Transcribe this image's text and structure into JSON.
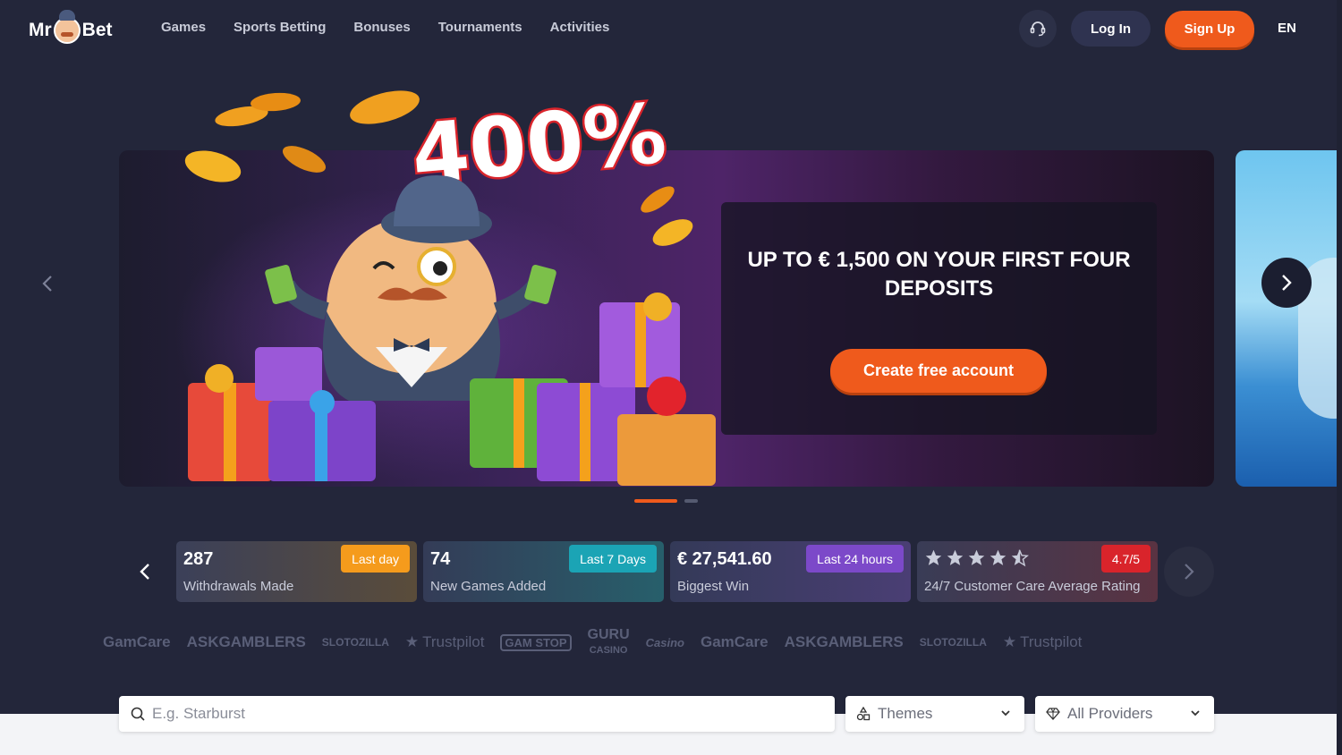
{
  "brand": {
    "name_left": "Mr",
    "name_right": "Bet"
  },
  "nav": {
    "items": [
      "Games",
      "Sports Betting",
      "Bonuses",
      "Tournaments",
      "Activities"
    ]
  },
  "header": {
    "login_label": "Log In",
    "signup_label": "Sign Up",
    "language": "EN",
    "support_icon": "headset-icon"
  },
  "hero": {
    "headline": "400%",
    "promo_title": "UP TO € 1,500 ON YOUR FIRST FOUR DEPOSITS",
    "cta_label": "Create free account",
    "slides_total": 2,
    "active_slide": 1
  },
  "stats": [
    {
      "value": "287",
      "label": "Withdrawals Made",
      "badge": "Last day",
      "badge_color": "#f59b1c"
    },
    {
      "value": "74",
      "label": "New Games Added",
      "badge": "Last 7 Days",
      "badge_color": "#1ba4b5"
    },
    {
      "value": "€ 27,541.60",
      "label": "Biggest Win",
      "badge": "Last 24 hours",
      "badge_color": "#7c49c9"
    },
    {
      "rating_stars": 4.5,
      "label": "24/7 Customer Care Average Rating",
      "badge": "4.7/5",
      "badge_color": "#d9242b"
    }
  ],
  "trust_logos": [
    "GamCare",
    "ASKGAMBLERS",
    "SLOTOZILLA",
    "Trustpilot",
    "GAM STOP",
    "GURU",
    "CASINO",
    "Casino",
    "GamCare",
    "ASKGAMBLERS",
    "SLOTOZILLA",
    "Trustpilot"
  ],
  "search": {
    "placeholder": "E.g. Starburst",
    "value": ""
  },
  "filters": {
    "themes_label": "Themes",
    "providers_label": "All Providers"
  },
  "colors": {
    "accent": "#ef5a1c",
    "background": "#23263a"
  }
}
